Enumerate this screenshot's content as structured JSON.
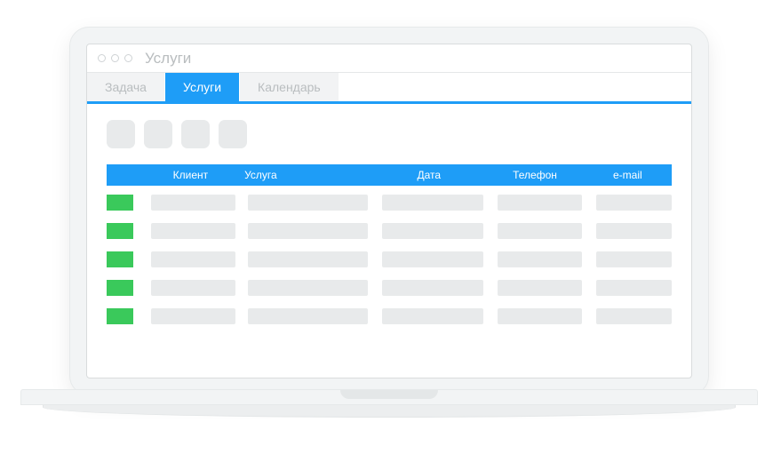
{
  "window": {
    "title": "Услуги"
  },
  "tabs": [
    {
      "label": "Задача",
      "active": false
    },
    {
      "label": "Услуги",
      "active": true
    },
    {
      "label": "Календарь",
      "active": false
    }
  ],
  "toolbar": {
    "buttons": [
      "",
      "",
      "",
      ""
    ]
  },
  "table": {
    "columns": {
      "client": "Клиент",
      "service": "Услуга",
      "date": "Дата",
      "phone": "Телефон",
      "email": "e-mail"
    },
    "rows": [
      {
        "status_color": "#3ac95b"
      },
      {
        "status_color": "#3ac95b"
      },
      {
        "status_color": "#3ac95b"
      },
      {
        "status_color": "#3ac95b"
      },
      {
        "status_color": "#3ac95b"
      }
    ]
  },
  "colors": {
    "accent": "#1e9df7",
    "status_green": "#3ac95b",
    "placeholder": "#e8eaeb"
  }
}
